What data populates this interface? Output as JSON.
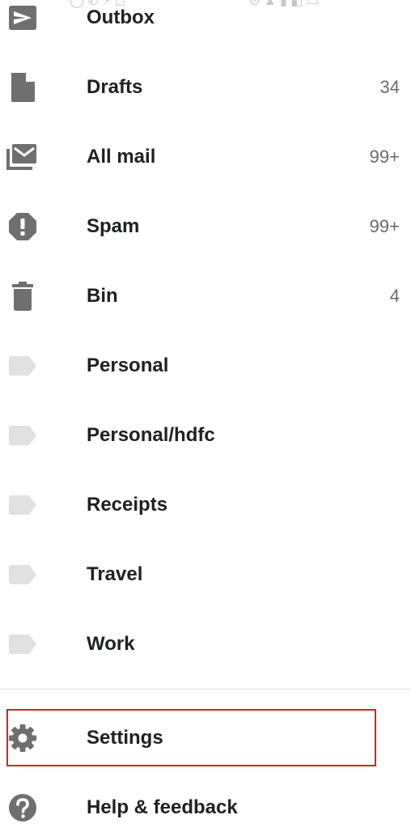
{
  "status_bar": {
    "left_glyphs": "◯ ✆ ⚡ ◻",
    "right_glyphs": "⊙ ▲ ▮ ◧ ▭"
  },
  "drawer": {
    "items": [
      {
        "label": "Outbox",
        "count": "",
        "icon": "send-icon"
      },
      {
        "label": "Drafts",
        "count": "34",
        "icon": "draft-file-icon"
      },
      {
        "label": "All mail",
        "count": "99+",
        "icon": "all-mail-icon"
      },
      {
        "label": "Spam",
        "count": "99+",
        "icon": "spam-icon"
      },
      {
        "label": "Bin",
        "count": "4",
        "icon": "bin-icon"
      },
      {
        "label": "Personal",
        "count": "",
        "icon": "label-icon"
      },
      {
        "label": "Personal/hdfc",
        "count": "",
        "icon": "label-icon"
      },
      {
        "label": "Receipts",
        "count": "",
        "icon": "label-icon"
      },
      {
        "label": "Travel",
        "count": "",
        "icon": "label-icon"
      },
      {
        "label": "Work",
        "count": "",
        "icon": "label-icon"
      }
    ],
    "settings_label": "Settings",
    "help_label": "Help & feedback"
  },
  "colors": {
    "icon_dark": "#6f6f6f",
    "icon_label": "#e1e1e1",
    "highlight": "#d0242b",
    "text": "#202124",
    "count_text": "#6b6b6b"
  }
}
